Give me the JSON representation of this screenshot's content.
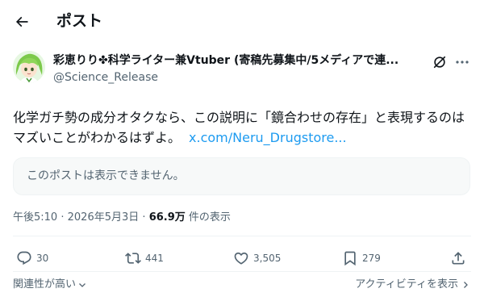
{
  "header": {
    "title": "ポスト",
    "back_icon": "arrow-left-icon"
  },
  "author": {
    "name": "彩恵りり✤科学ライター兼Vtuber (寄稿先募集中/5メディアで連...",
    "handle": "@Science_Release",
    "avatar": "anime-avatar-green-hair"
  },
  "tweet": {
    "text": "化学ガチ勢の成分オタクなら、この説明に「鏡合わせの存在」と表現するのはマズいことがわかるはずよ。",
    "link": "x.com/Neru_Drugstore..."
  },
  "quote": {
    "text": "このポストは表示できません。"
  },
  "meta": {
    "time": "午後5:10",
    "separator": "·",
    "date": "2026年5月3日",
    "views": "66.9万",
    "views_suffix": "件の表示"
  },
  "actions": {
    "replies": "30",
    "reposts": "441",
    "likes": "3,505",
    "bookmarks": "279"
  },
  "footer": {
    "relevance": "関連性が高い",
    "activity": "アクティビティを表示"
  },
  "colors": {
    "text": "#0f1419",
    "secondary": "#536471",
    "link": "#1d9bf0",
    "border": "#eff3f4"
  }
}
